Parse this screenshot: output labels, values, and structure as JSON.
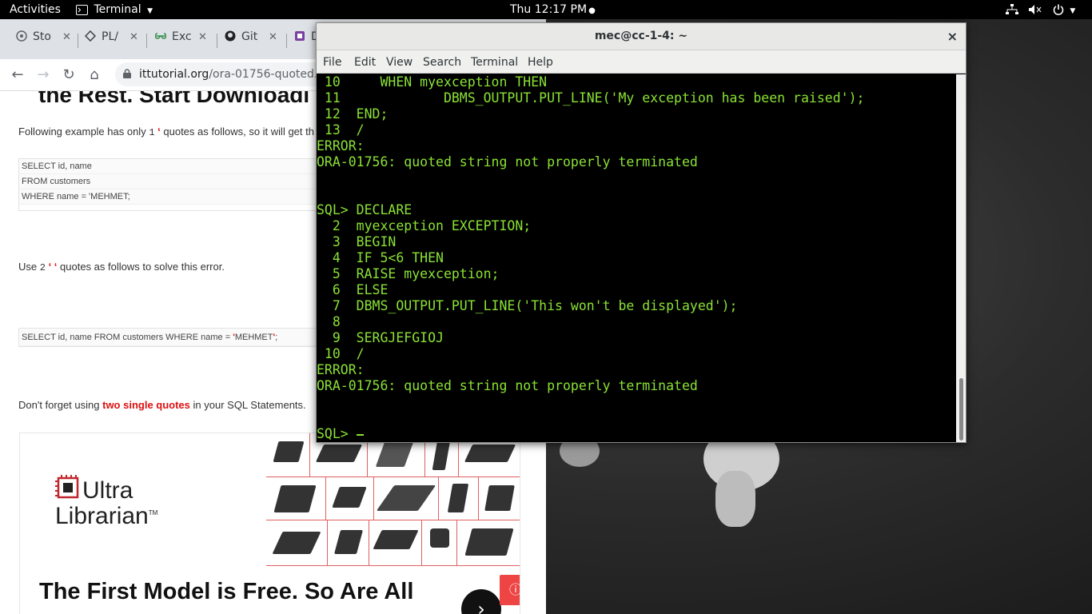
{
  "topbar": {
    "activities": "Activities",
    "app_menu": "Terminal",
    "clock": "Thu 12:17 PM"
  },
  "browser": {
    "tabs": [
      {
        "label": "Sto",
        "icon": "stackoverflow-icon"
      },
      {
        "label": "PL/",
        "icon": "plsql-icon"
      },
      {
        "label": "Exc",
        "icon": "geeksforgeeks-icon"
      },
      {
        "label": "Git",
        "icon": "github-icon"
      },
      {
        "label": "D",
        "icon": "bookmark-icon"
      }
    ],
    "url_host": "ittutorial.org",
    "url_path": "/ora-01756-quoted..."
  },
  "article": {
    "top_heading": "the Rest. Start Downloadi",
    "para1_before": "Following example has only ",
    "para1_num": "1",
    "para1_quote": "‘",
    "para1_after": " quotes as follows, so it will get th",
    "code1": [
      "SELECT id, name",
      "FROM customers",
      "WHERE name = 'MEHMET;"
    ],
    "para2_before": "Use ",
    "para2_num": "2",
    "para2_quote": "‘ ‘",
    "para2_after": " quotes as follows to solve this error.",
    "code2_before": "SELECT id, name FROM customers WHERE name = ",
    "code2_red1": "'",
    "code2_mid": "MEHMET",
    "code2_red2": "'",
    "code2_after": ";",
    "para3_before": "Don't forget using  ",
    "para3_emph": "two single quotes",
    "para3_after": " in your SQL Statements."
  },
  "ad": {
    "logo_line1": "Ultra",
    "logo_line2": "Librarian",
    "logo_tm": "TM",
    "headline": "The First Model is Free. So Are All",
    "next": "›",
    "info": "ⓘ"
  },
  "terminal": {
    "title": "mec@cc-1-4: ~",
    "close": "×",
    "menu": [
      "File",
      "Edit",
      "View",
      "Search",
      "Terminal",
      "Help"
    ],
    "lines": [
      " 10     WHEN myexception THEN",
      " 11             DBMS_OUTPUT.PUT_LINE('My exception has been raised');",
      " 12  END;",
      " 13  /",
      "ERROR:",
      "ORA-01756: quoted string not properly terminated",
      "",
      "",
      "SQL> DECLARE",
      "  2  myexception EXCEPTION;",
      "  3  BEGIN",
      "  4  IF 5<6 THEN",
      "  5  RAISE myexception;",
      "  6  ELSE",
      "  7  DBMS_OUTPUT.PUT_LINE('This won't be displayed');",
      "  8",
      "  9  SERGJEFGIOJ",
      " 10  /",
      "ERROR:",
      "ORA-01756: quoted string not properly terminated",
      "",
      "",
      "SQL> "
    ],
    "text_color": "#8ae234"
  }
}
